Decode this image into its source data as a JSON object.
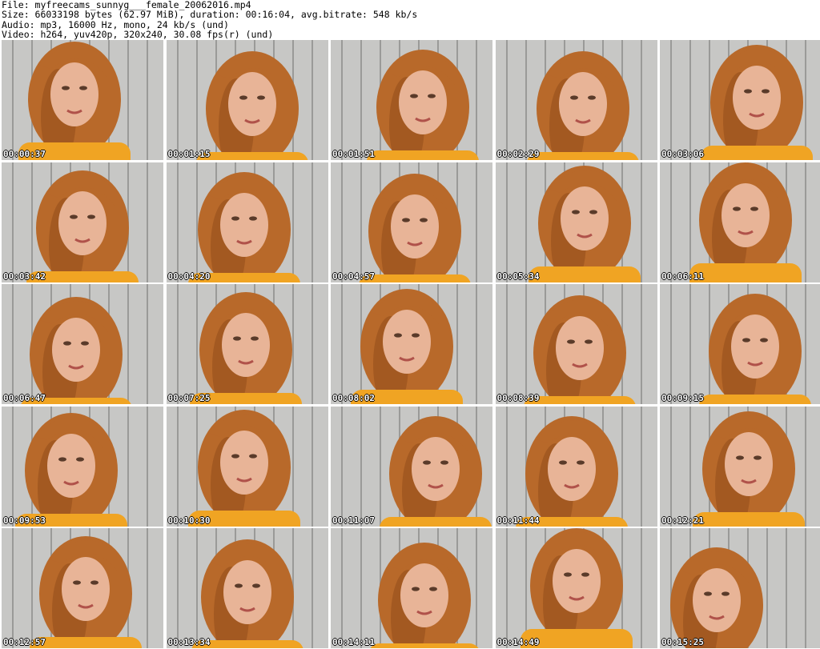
{
  "header": {
    "file_line": "File: myfreecams_sunnyg___female_20062016.mp4",
    "size_line": "Size: 66033198 bytes (62.97 MiB), duration: 00:16:04, avg.bitrate: 548 kb/s",
    "audio_line": "Audio: mp3, 16000 Hz, mono, 24 kb/s (und)",
    "video_line": "Video: h264, yuv420p, 320x240, 30.08 fps(r) (und)"
  },
  "colors": {
    "background_wall": "#c7c7c5",
    "plank_line": "#9a9a98",
    "hair": "#b8692a",
    "hair_dark": "#8a4716",
    "skin": "#e8b497",
    "shirt": "#f0a423",
    "timestamp": "#ffffff"
  },
  "thumbnails": [
    {
      "timestamp": "00:00:37"
    },
    {
      "timestamp": "00:01:15"
    },
    {
      "timestamp": "00:01:51"
    },
    {
      "timestamp": "00:02:29"
    },
    {
      "timestamp": "00:03:06"
    },
    {
      "timestamp": "00:03:42"
    },
    {
      "timestamp": "00:04:20"
    },
    {
      "timestamp": "00:04:57"
    },
    {
      "timestamp": "00:05:34"
    },
    {
      "timestamp": "00:06:11"
    },
    {
      "timestamp": "00:06:47"
    },
    {
      "timestamp": "00:07:25"
    },
    {
      "timestamp": "00:08:02"
    },
    {
      "timestamp": "00:08:39"
    },
    {
      "timestamp": "00:09:15"
    },
    {
      "timestamp": "00:09:53"
    },
    {
      "timestamp": "00:10:30"
    },
    {
      "timestamp": "00:11:07"
    },
    {
      "timestamp": "00:11:44"
    },
    {
      "timestamp": "00:12:21"
    },
    {
      "timestamp": "00:12:57"
    },
    {
      "timestamp": "00:13:34"
    },
    {
      "timestamp": "00:14:11"
    },
    {
      "timestamp": "00:14:49"
    },
    {
      "timestamp": "00:15:25"
    }
  ]
}
